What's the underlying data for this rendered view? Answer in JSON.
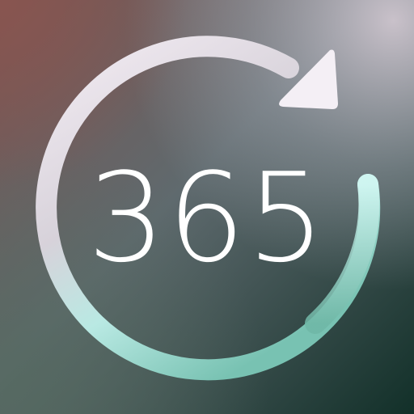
{
  "icon": {
    "number": "365",
    "symbol": "circular-refresh-arrow-icon"
  },
  "colors": {
    "top_left": "#7a5450",
    "top_right": "#b9b4bf",
    "center": "#5f6a6e",
    "bottom_left": "#3e4d48",
    "bottom_right": "#123029",
    "ring_top": "#f5eef5",
    "ring_left": "#d8d0d8",
    "ring_right": "#b8f0ea",
    "ring_bottom": "#7ec6b6",
    "text": "#ffffff"
  }
}
